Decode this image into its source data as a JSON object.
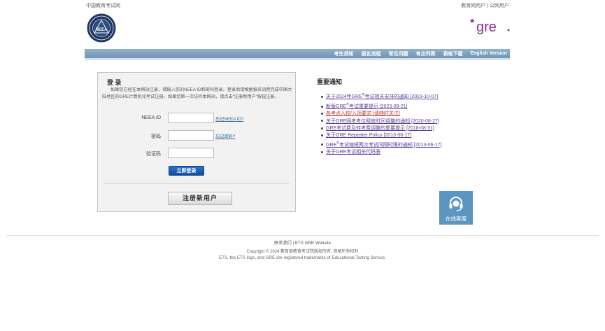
{
  "header": {
    "top_left_link": "中国教育考试网",
    "top_right_links": [
      "教育网用户",
      "公网用户"
    ],
    "top_right_separator": "|",
    "neea_logo_text": "NEEA",
    "gre_logo_text": "gre"
  },
  "nav": {
    "items": [
      "考生须知",
      "报名流程",
      "常见问题",
      "考点列表",
      "表格下载",
      "English Version"
    ]
  },
  "login": {
    "title": "登 录",
    "description": "如果您已经在本网站注册，请输入您的NEEA ID和密码登录。登录后请根据报名流程完成中国大陆地区的GRE计算机化考试注册。如果您第一次访问本网站，请点击“注册新用户”按钮注册。",
    "neea_id_label": "NEEA ID",
    "neea_id_value": "",
    "forgot_id": "忘记NEEA ID?",
    "password_label": "密码",
    "password_value": "",
    "forgot_password": "忘记密码?",
    "captcha_label": "验证码",
    "captcha_value": "",
    "login_button": "立即登录",
    "register_button": "注册新用户"
  },
  "notices": {
    "title": "重要通知",
    "items": [
      {
        "pre": "关于2024年GRE",
        "sup": "®",
        "post": "考试相关安排的通知 [2023-10-07]",
        "red": false
      },
      {
        "pre": "新版GRE",
        "sup": "®",
        "post": "考试重要提示 [2023-09-21]",
        "red": false
      },
      {
        "pre": "各考点入校/入场要求 [请随时关注]",
        "sup": "",
        "post": "",
        "red": true
      },
      {
        "pre": "关于GRE网考考位释放时间调整的通知 [2020-08-27]",
        "sup": "",
        "post": "",
        "red": false
      },
      {
        "pre": "GRE考试费及转考费调整的重要提示 [2018-08-31]",
        "sup": "",
        "post": "",
        "red": false
      },
      {
        "pre": "关于GRE Repeater Policy [2013-06-17]",
        "sup": "",
        "post": "",
        "red": false
      },
      {
        "pre": "GRE",
        "sup": "®",
        "post": "考试缩短两次考试间隔时限的通知 [2013-06-17]",
        "red": false
      },
      {
        "pre": "关于GRE考试相关代码表",
        "sup": "",
        "post": "",
        "red": false
      }
    ]
  },
  "service": {
    "label": "在线客服"
  },
  "footer": {
    "contact": "联系我们",
    "separator": "|",
    "ets_site": "ETS GRE Website",
    "copyright": "Copyright © 2024 教育部教育考试院版权所有, 保留所有权利",
    "trademark": "ETS, the ETS logo, and GRE are registered trademarks of Educational Testing Service."
  },
  "colors": {
    "nav_bar": "#7ba1c1",
    "login_button": "#1a5fb4",
    "gre_purple": "#8e2b8f",
    "service_box": "#5c95bf",
    "notice_link": "#5a3f9b",
    "notice_red": "#c0392b"
  }
}
